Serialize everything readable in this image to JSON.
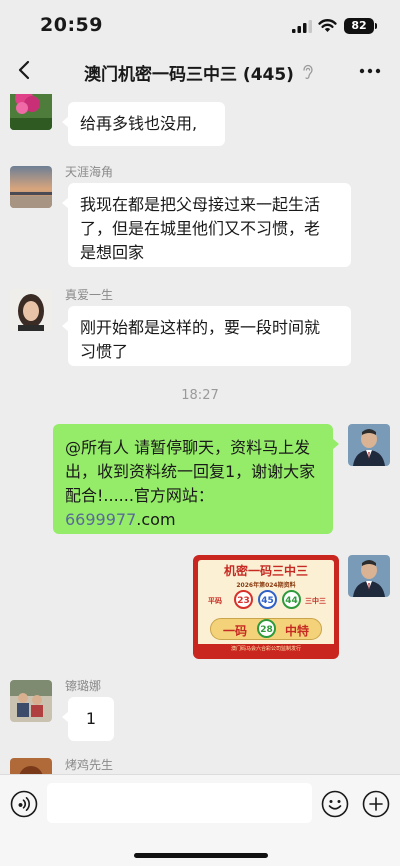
{
  "status": {
    "time": "20:59",
    "battery": "82"
  },
  "nav": {
    "title": "澳门机密一码三中三 (445)"
  },
  "messages": [
    {
      "sender": "",
      "text": "给再多钱也没用,"
    },
    {
      "sender": "天涯海角",
      "lines": [
        "我现在都是把父母接过来一起生活",
        "了，但是在城里他们又不习惯，老",
        "是想回家"
      ]
    },
    {
      "sender": "真爱一生",
      "lines": [
        "刚开始都是这样的，要一段时间就",
        "习惯了"
      ]
    },
    {
      "timestamp": "18:27"
    },
    {
      "sender": "",
      "lines": [
        "@所有人 请暂停聊天，资料马上发",
        "出，收到资料统一回复1，谢谢大家"
      ],
      "line3_prefix": "配合!......官方网站：",
      "line3_link": "6699977",
      "line3_suffix": ".com"
    },
    {
      "lottery": {
        "title": "机密一码三中三",
        "issue": "2026年第024期资料",
        "left_label": "平码",
        "right_label": "三中三",
        "numbers": [
          "23",
          "45",
          "44"
        ],
        "banner_left": "一码",
        "special_number": "28",
        "banner_right": "中特",
        "footer": "澳门码马会六合彩公司监制发行"
      }
    },
    {
      "sender": "镲璐娜",
      "text": "1"
    },
    {
      "sender": "烤鸡先生"
    }
  ],
  "colors": {
    "chat_background": "#ededed",
    "own_bubble": "#95ec69",
    "other_bubble": "#ffffff",
    "link": "#576b95"
  },
  "icons": {
    "back": "chevron-left-icon",
    "more": "more-dots-icon",
    "voice": "voice-icon",
    "emoji": "emoji-icon",
    "plus": "plus-icon"
  }
}
